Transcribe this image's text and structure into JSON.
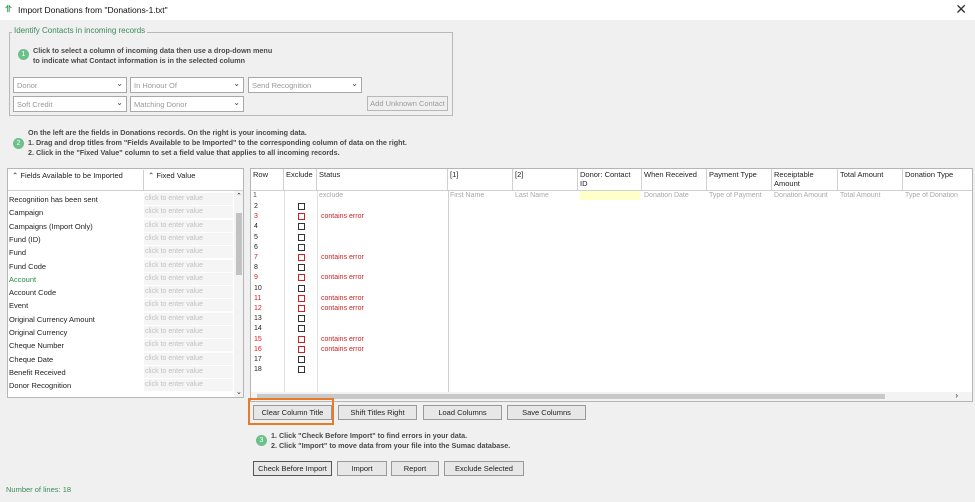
{
  "window": {
    "title": "Import Donations from \"Donations-1.txt\"",
    "app_icon": "sumac-icon",
    "close_glyph": "✕"
  },
  "identify": {
    "legend": "Identify Contacts in incoming records",
    "step": "1",
    "instruction_1": "Click to select a column of incoming data then use a drop-down menu",
    "instruction_2": "to indicate what Contact information is in the selected column",
    "combos": [
      "Donor",
      "In Honour Of",
      "Send Recognition",
      "Soft Credit",
      "Matching Donor"
    ],
    "add_unknown_label": "Add Unknown Contact"
  },
  "step2": {
    "step": "2",
    "line_1": "On the left are the fields in Donations records.  On the right is your incoming data.",
    "line_2": "1. Drag and drop titles from \"Fields Available to be Imported\" to the corresponding column of data on the right.",
    "line_3": "2. Click in the \"Fixed Value\" column to set a field value that applies to all incoming records."
  },
  "fields_table": {
    "header_field": "Fields Available to be Imported",
    "header_fixed": "Fixed Value",
    "placeholder": "click to enter value",
    "rows": [
      {
        "name": "Recognition has been sent",
        "highlight": false
      },
      {
        "name": "Campaign",
        "highlight": false
      },
      {
        "name": "Campaigns (Import Only)",
        "highlight": false
      },
      {
        "name": "Fund (ID)",
        "highlight": false
      },
      {
        "name": "Fund",
        "highlight": false
      },
      {
        "name": "Fund Code",
        "highlight": false
      },
      {
        "name": "Account",
        "highlight": true
      },
      {
        "name": "Account Code",
        "highlight": false
      },
      {
        "name": "Event",
        "highlight": false
      },
      {
        "name": "Original Currency Amount",
        "highlight": false
      },
      {
        "name": "Original Currency",
        "highlight": false
      },
      {
        "name": "Cheque Number",
        "highlight": false
      },
      {
        "name": "Cheque Date",
        "highlight": false
      },
      {
        "name": "Benefit Received",
        "highlight": false
      },
      {
        "name": "Donor Recognition",
        "highlight": false
      }
    ],
    "highlight_color": "#2a8a4a"
  },
  "data_grid": {
    "columns": [
      "Row",
      "Exclude",
      "Status",
      "[1]",
      "[2]",
      "Donor: Contact ID",
      "When Received",
      "Payment Type",
      "Receiptable Amount",
      "Total Amount",
      "Donation Type"
    ],
    "first_row_values": [
      "1",
      "",
      "exclude",
      "First Name",
      "Last Name",
      "",
      "Donation Date",
      "Type of Payment",
      "Donation Amount",
      "Total Amount",
      "Type of Donation"
    ],
    "rows": [
      {
        "n": "2",
        "status": "",
        "error": false
      },
      {
        "n": "3",
        "status": "contains error",
        "error": true
      },
      {
        "n": "4",
        "status": "",
        "error": false
      },
      {
        "n": "5",
        "status": "",
        "error": false
      },
      {
        "n": "6",
        "status": "",
        "error": false
      },
      {
        "n": "7",
        "status": "contains error",
        "error": true
      },
      {
        "n": "8",
        "status": "",
        "error": false
      },
      {
        "n": "9",
        "status": "contains error",
        "error": true
      },
      {
        "n": "10",
        "status": "",
        "error": false
      },
      {
        "n": "11",
        "status": "contains error",
        "error": true
      },
      {
        "n": "12",
        "status": "contains error",
        "error": true
      },
      {
        "n": "13",
        "status": "",
        "error": false
      },
      {
        "n": "14",
        "status": "",
        "error": false
      },
      {
        "n": "15",
        "status": "contains error",
        "error": true
      },
      {
        "n": "16",
        "status": "contains error",
        "error": true
      },
      {
        "n": "17",
        "status": "",
        "error": false
      },
      {
        "n": "18",
        "status": "",
        "error": false
      }
    ],
    "error_color": "#d02020",
    "selected_cell_color": "#ffffc8"
  },
  "column_buttons": {
    "clear": "Clear Column Title",
    "shift": "Shift Titles Right",
    "load": "Load Columns",
    "save": "Save Columns"
  },
  "step3": {
    "step": "3",
    "line_1": "1. Click \"Check Before Import\" to find errors in your data.",
    "line_2": "2. Click \"Import\" to move data from your file into the Sumac database."
  },
  "action_buttons": {
    "check": "Check Before Import",
    "import": "Import",
    "report": "Report",
    "exclude": "Exclude Selected"
  },
  "footer": {
    "lines": "Number of lines: 18"
  }
}
